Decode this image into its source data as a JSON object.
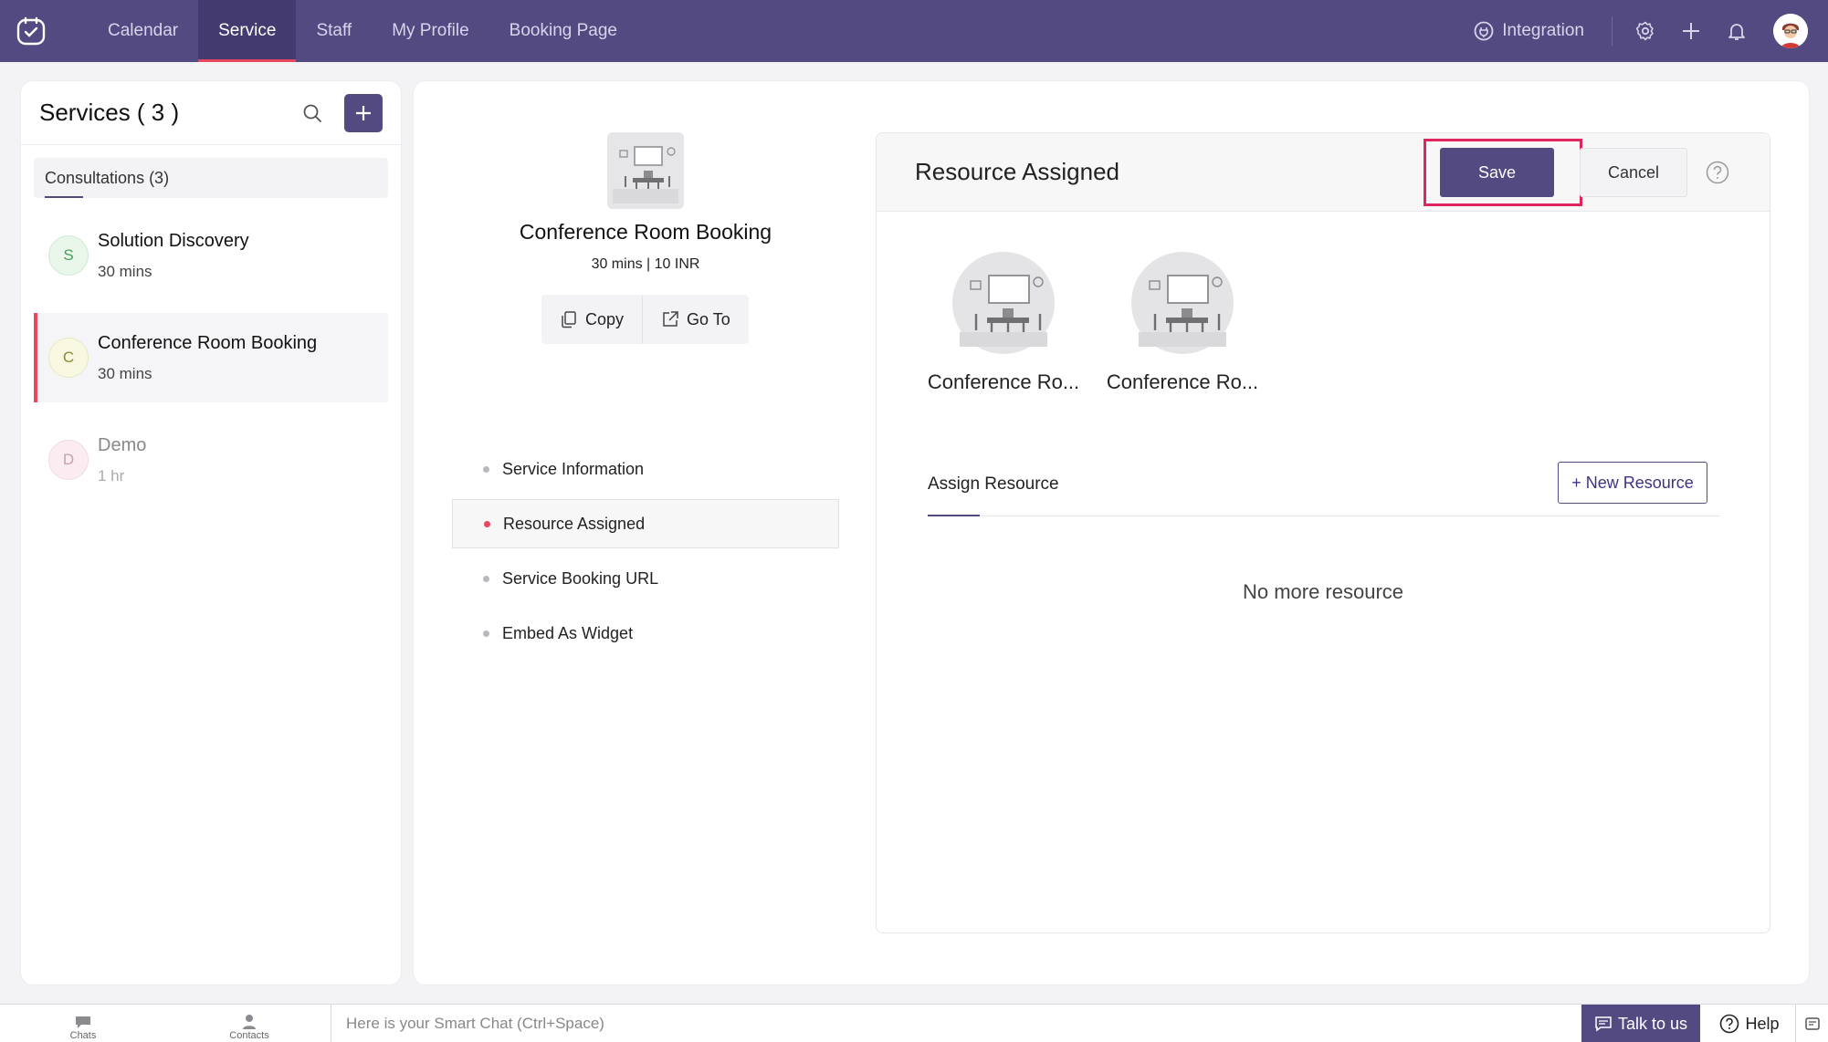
{
  "nav": {
    "items": [
      {
        "label": "Calendar",
        "active": false
      },
      {
        "label": "Service",
        "active": true
      },
      {
        "label": "Staff",
        "active": false
      },
      {
        "label": "My Profile",
        "active": false
      },
      {
        "label": "Booking Page",
        "active": false
      }
    ],
    "integration_label": "Integration",
    "icons": [
      "app-logo-icon",
      "integration-icon",
      "gear-icon",
      "plus-icon",
      "bell-icon",
      "user-avatar"
    ]
  },
  "services_panel": {
    "title": "Services ( 3 )",
    "category": "Consultations (3)",
    "items": [
      {
        "initial": "S",
        "name": "Solution Discovery",
        "duration": "30 mins",
        "avatar_bg": "#e8f7ea",
        "avatar_color": "#4a9b5a"
      },
      {
        "initial": "C",
        "name": "Conference Room Booking",
        "duration": "30 mins",
        "avatar_bg": "#f8f8e0",
        "avatar_color": "#8a8a3a"
      },
      {
        "initial": "D",
        "name": "Demo",
        "duration": "1 hr",
        "avatar_bg": "#fbecf2",
        "avatar_color": "#c7a0b3"
      }
    ]
  },
  "service_detail": {
    "title": "Conference Room Booking",
    "meta": "30 mins | 10 INR",
    "copy_label": "Copy",
    "goto_label": "Go To",
    "menu": [
      {
        "label": "Service Information",
        "active": false
      },
      {
        "label": "Resource Assigned",
        "active": true
      },
      {
        "label": "Service Booking URL",
        "active": false
      },
      {
        "label": "Embed As Widget",
        "active": false
      }
    ]
  },
  "resource_card": {
    "title": "Resource Assigned",
    "save_label": "Save",
    "cancel_label": "Cancel",
    "resources": [
      {
        "name": "Conference Ro..."
      },
      {
        "name": "Conference Ro..."
      }
    ],
    "assign_label": "Assign Resource",
    "new_resource_label": "+ New Resource",
    "empty_text": "No more resource"
  },
  "bottom_bar": {
    "chats_label": "Chats",
    "contacts_label": "Contacts",
    "chat_placeholder": "Here is your Smart Chat (Ctrl+Space)",
    "talk_label": "Talk to us",
    "help_label": "Help"
  },
  "colors": {
    "brand": "#544a82",
    "accent": "#e8475f",
    "highlight": "#e0245e"
  }
}
